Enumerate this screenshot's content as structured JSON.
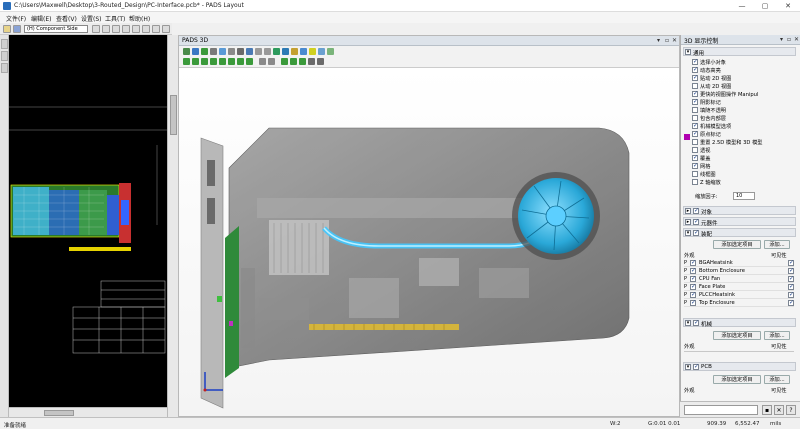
{
  "window": {
    "title": "C:\\Users\\Maxwell\\Desktop\\3-Routed_Design\\PC-Interface.pcb* - PADS Layout",
    "controls": [
      "—",
      "▢",
      "✕"
    ]
  },
  "menu": [
    "文件(F)",
    "编辑(E)",
    "查看(V)",
    "设置(S)",
    "工具(T)",
    "帮助(H)"
  ],
  "toolbar": {
    "layer_select": "(H) Component Side"
  },
  "view3d": {
    "tab_title": "PADS 3D"
  },
  "panel": {
    "title": "3D 显示控制",
    "general_section": "通用",
    "options": [
      {
        "label": "选择小对象",
        "checked": true
      },
      {
        "label": "动态高亮",
        "checked": true
      },
      {
        "label": "贴动 2D 视图",
        "checked": true
      },
      {
        "label": "从动 2D 视图",
        "checked": false
      },
      {
        "label": "更快的视图操作 Manipul",
        "checked": true
      },
      {
        "label": "阴影标记",
        "checked": true
      },
      {
        "label": "填随不透明",
        "checked": false
      },
      {
        "label": "包含内部层",
        "checked": false
      },
      {
        "label": "机械模型选项",
        "checked": true
      },
      {
        "label": "原点标记",
        "checked": true
      },
      {
        "label": "重置 2.5D 模型和 3D 模型",
        "checked": false
      },
      {
        "label": "透视",
        "checked": false
      },
      {
        "label": "覆盖",
        "checked": true
      },
      {
        "label": "网格",
        "checked": true
      },
      {
        "label": "线框图",
        "checked": false
      },
      {
        "label": "Z 轴缩放",
        "checked": false
      }
    ],
    "origin_marker_color": "#b000b0",
    "scale_label": "缩放因子:",
    "scale_value": "10",
    "sections": {
      "objects": "对象",
      "components": "元器件",
      "assembly": "装配",
      "mechanical": "机械",
      "pcb": "PCB"
    },
    "add_selected": "添加选定项目",
    "add": "添加...",
    "col_appearance": "外观",
    "col_visibility": "可见性",
    "assembly_items": [
      {
        "prefix": "P",
        "name": "BGAHeatsink"
      },
      {
        "prefix": "P",
        "name": "Bottom Enclosure"
      },
      {
        "prefix": "P",
        "name": "CPU Fan"
      },
      {
        "prefix": "P",
        "name": "Face Plate"
      },
      {
        "prefix": "P",
        "name": "PLCCHeatsink"
      },
      {
        "prefix": "P",
        "name": "Top Enclosure"
      }
    ]
  },
  "status": {
    "ready": "准备就绪",
    "w": "W:2",
    "g": "G:0.01 0.01",
    "x": "909.39",
    "y": "6,552.47",
    "units": "mils"
  }
}
